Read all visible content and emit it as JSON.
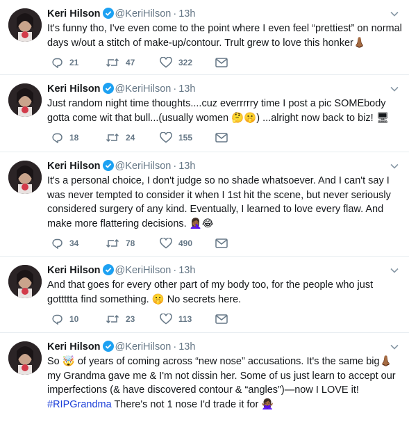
{
  "tweets": [
    {
      "name": "Keri Hilson",
      "handle": "@KeriHilson",
      "time": "13h",
      "lines": [
        "It's funny tho, I've even come to the point where I even feel “prettiest” on normal",
        "days w/out a stitch of make-up/contour. Trult grew to love this honker👃🏾"
      ],
      "replies": "21",
      "retweets": "47",
      "likes": "322"
    },
    {
      "name": "Keri Hilson",
      "handle": "@KeriHilson",
      "time": "13h",
      "lines": [
        "Just random night time thoughts....cuz everrrrry time I post a pic SOMEbody",
        "gotta come wit that bull...(usually women 🤔🤫) ...alright now back to biz! 🖥"
      ],
      "replies": "18",
      "retweets": "24",
      "likes": "155"
    },
    {
      "name": "Keri Hilson",
      "handle": "@KeriHilson",
      "time": "13h",
      "lines": [
        "It's a personal choice, I don't judge so no shade whatsoever. And I can't say I",
        "was never tempted to consider it when I 1st hit the scene, but never seriously",
        "considered surgery of any kind. Eventually, I learned to love every flaw. And",
        "make more flattering decisions. 🤦🏾‍♀️😂"
      ],
      "replies": "34",
      "retweets": "78",
      "likes": "490"
    },
    {
      "name": "Keri Hilson",
      "handle": "@KeriHilson",
      "time": "13h",
      "lines": [
        "And that goes for every other part of my body too, for the people who just",
        "gottttta find something. 🤫 No secrets here."
      ],
      "replies": "10",
      "retweets": "23",
      "likes": "113"
    },
    {
      "name": "Keri Hilson",
      "handle": "@KeriHilson",
      "time": "13h",
      "lines": [
        "So 🤯 of years of coming across “new nose” accusations. It's the same big👃🏾",
        "my Grandma gave me & I'm not dissin her. Some of us just learn to accept our",
        "imperfections (& have discovered contour & “angles”)—now I LOVE it!",
        "#RIPGrandma There's not 1 nose I'd trade it for 🙅🏾‍♀️"
      ],
      "hashtag": "#RIPGrandma",
      "replies": "",
      "retweets": "",
      "likes": ""
    }
  ],
  "colors": {
    "text": "#14171a",
    "secondary": "#657786",
    "verified": "#1da1f2",
    "hashtag": "#1b3ed8",
    "divider": "#e6ecf0"
  },
  "icons": [
    "verified-badge-icon",
    "caret-down-icon",
    "reply-icon",
    "retweet-icon",
    "like-heart-icon",
    "direct-message-icon"
  ]
}
